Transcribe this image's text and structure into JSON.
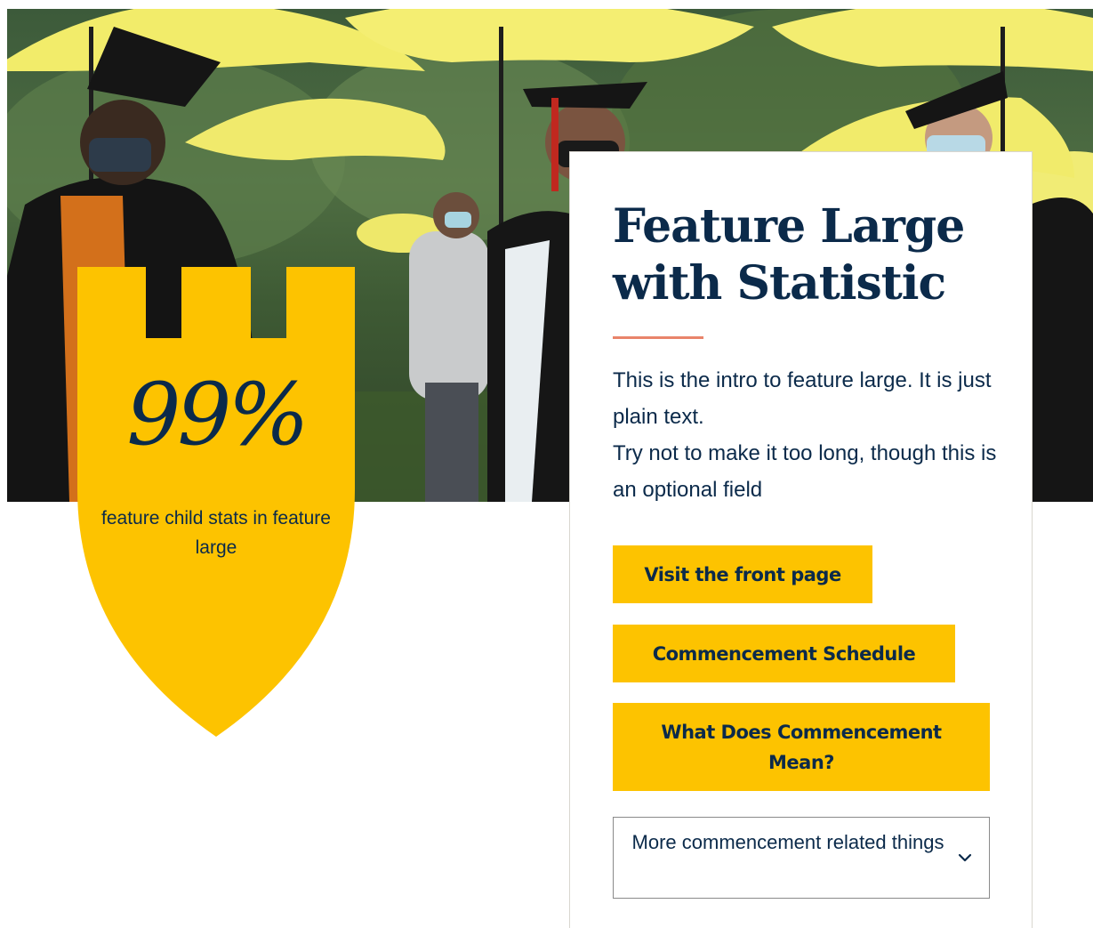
{
  "hero": {
    "image": "graduates-under-yellow-umbrellas-photo",
    "accent_color": "#fdc300"
  },
  "statistic": {
    "value": "99%",
    "label": "feature child stats in feature large",
    "shape": "shield",
    "fill_color": "#fdc300",
    "text_color": "#0b2a4a"
  },
  "feature": {
    "title": "Feature Large with Statistic",
    "intro_lines": [
      "This is the intro to feature large. It is just plain text.",
      "Try not to make it too long, though this is an optional field"
    ],
    "rule_color": "#e9846a"
  },
  "buttons": [
    {
      "label": "Visit the front page"
    },
    {
      "label": "Commencement Schedule"
    },
    {
      "label": "What Does Commencement Mean?"
    }
  ],
  "dropdown": {
    "label": "More commencement related things",
    "icon": "chevron-down-icon"
  }
}
